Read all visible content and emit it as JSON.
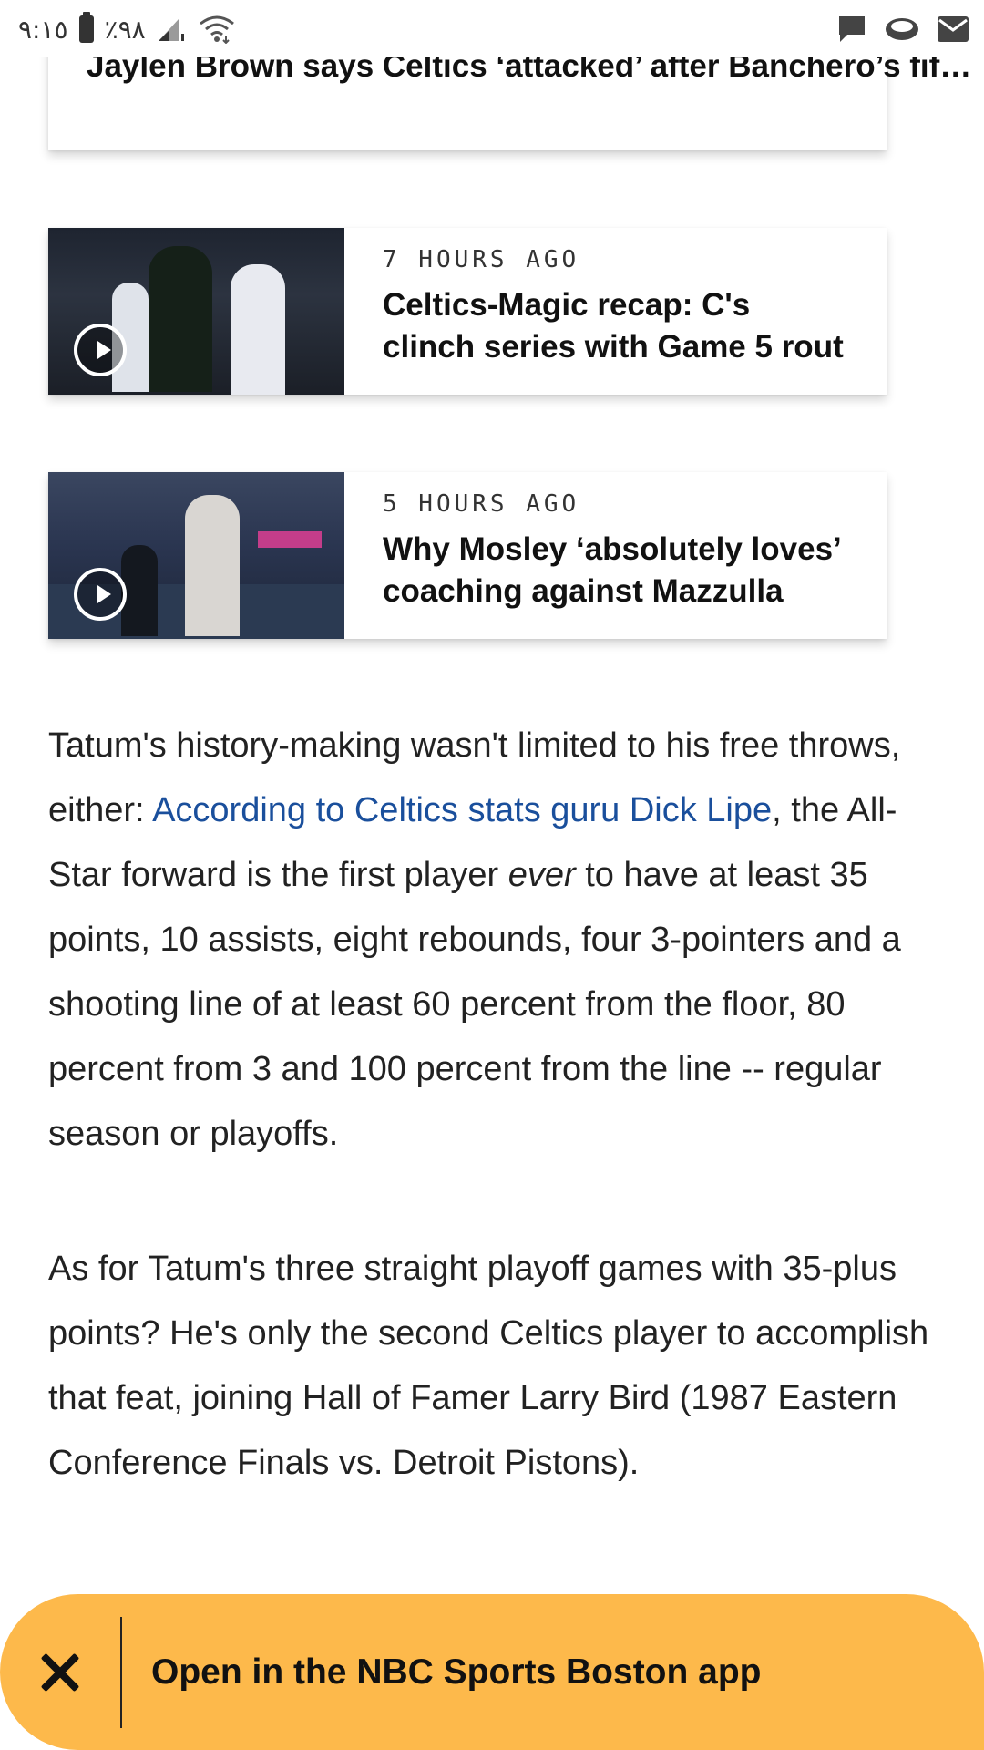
{
  "status_bar": {
    "time": "٩:١٥",
    "battery": "٪٩٨",
    "icons": [
      "battery-icon",
      "signal-icon",
      "wifi-icon",
      "chat-icon",
      "app-icon",
      "mail-icon"
    ]
  },
  "related_videos": [
    {
      "time": "",
      "title": "Jaylen Brown says Celtics ‘attacked’ after Banchero’s fif…"
    },
    {
      "time": "7 HOURS AGO",
      "title": "Celtics-Magic recap: C's clinch series with Game 5 rout"
    },
    {
      "time": "5 HOURS AGO",
      "title": "Why Mosley ‘absolutely loves’ coaching against Mazzulla"
    }
  ],
  "article": {
    "p1_before": "Tatum's history-making wasn't limited to his free throws, either: ",
    "p1_link": "According to Celtics stats guru Dick Lipe",
    "p1_mid": ", the All-Star forward is the first player ",
    "p1_em": "ever",
    "p1_after": " to have at least 35 points, 10 assists, eight rebounds, four 3-pointers and a shooting line of at least 60 percent from the floor, 80 percent from 3 and 100 percent from the line -- regular season or playoffs.",
    "p2": "As for Tatum's three straight playoff games with 35-plus points? He's only the second Celtics player to accomplish that feat, joining Hall of Famer Larry Bird (1987 Eastern Conference Finals vs. Detroit Pistons)."
  },
  "app_banner": {
    "label": "Open in the NBC Sports Boston app"
  },
  "colors": {
    "link": "#1a4f9c",
    "banner": "#fdb94b"
  }
}
